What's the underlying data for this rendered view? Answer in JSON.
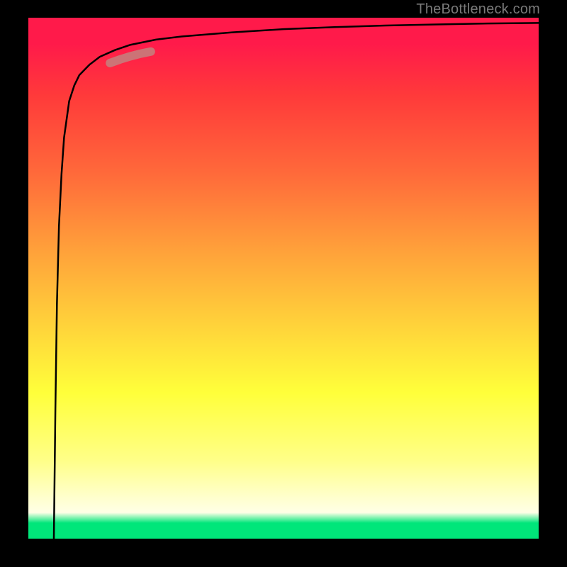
{
  "watermark": "TheBottleneck.com",
  "chart_data": {
    "type": "line",
    "title": "",
    "xlabel": "",
    "ylabel": "",
    "xlim": [
      0,
      100
    ],
    "ylim": [
      0,
      100
    ],
    "grid": false,
    "legend": false,
    "series": [
      {
        "name": "curve",
        "color": "#000000",
        "x": [
          5,
          5.3,
          5.6,
          6,
          6.5,
          7,
          8,
          9,
          10,
          12,
          14,
          17,
          20,
          25,
          30,
          40,
          50,
          60,
          70,
          80,
          90,
          100
        ],
        "y": [
          0,
          25,
          45,
          60,
          70,
          77,
          84,
          87,
          89,
          91,
          92.5,
          93.8,
          94.8,
          95.8,
          96.4,
          97.2,
          97.8,
          98.2,
          98.5,
          98.7,
          98.9,
          99
        ]
      },
      {
        "name": "highlight-segment",
        "color": "#c87b7b",
        "x": [
          16,
          18,
          20,
          22,
          24
        ],
        "y": [
          91.3,
          92,
          92.6,
          93.1,
          93.5
        ]
      }
    ],
    "gradient_stops": [
      {
        "pos": 0.0,
        "color": "#ff1a4a"
      },
      {
        "pos": 0.3,
        "color": "#ff6a3a"
      },
      {
        "pos": 0.6,
        "color": "#ffd63a"
      },
      {
        "pos": 0.85,
        "color": "#ffff88"
      },
      {
        "pos": 0.97,
        "color": "#00e67a"
      },
      {
        "pos": 1.0,
        "color": "#00e67a"
      }
    ]
  }
}
